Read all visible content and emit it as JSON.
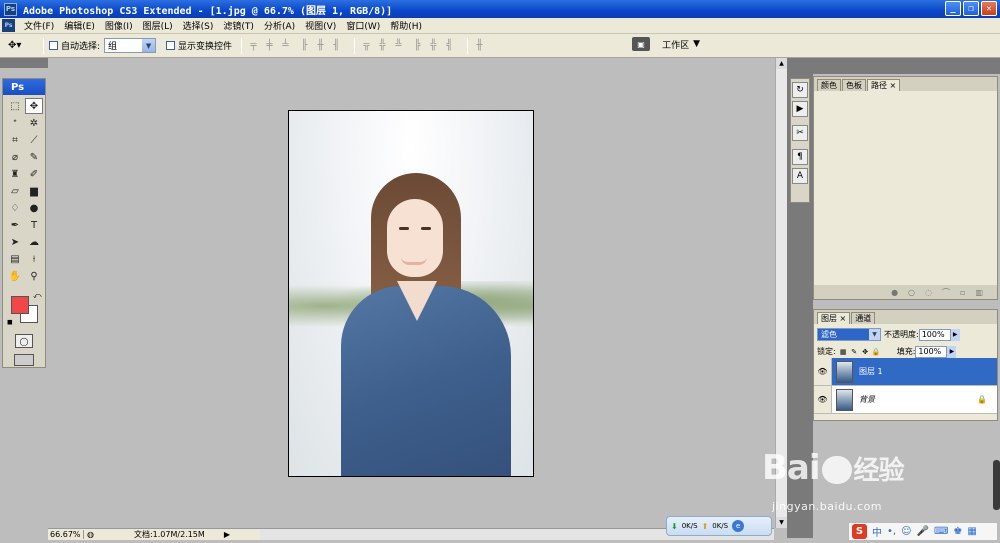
{
  "window": {
    "title": "Adobe Photoshop CS3 Extended - [1.jpg @ 66.7% (图层 1, RGB/8)]",
    "app_badge": "Ps"
  },
  "menubar": {
    "items": [
      "文件(F)",
      "编辑(E)",
      "图像(I)",
      "图层(L)",
      "选择(S)",
      "滤镜(T)",
      "分析(A)",
      "视图(V)",
      "窗口(W)",
      "帮助(H)"
    ]
  },
  "options": {
    "auto_select_label": "自动选择:",
    "auto_select_value": "组",
    "show_transform_label": "显示变换控件",
    "workspace_label": "工作区"
  },
  "toolbox": {
    "header": "Ps",
    "foreground_color": "#f04848",
    "background_color": "#ffffff"
  },
  "paths_panel": {
    "tabs": [
      "颜色",
      "色板",
      "路径"
    ]
  },
  "layers_panel": {
    "tabs": [
      "图层",
      "通道"
    ],
    "blend_mode": "滤色",
    "opacity_label": "不透明度:",
    "opacity_value": "100%",
    "lock_label": "锁定:",
    "fill_label": "填充:",
    "fill_value": "100%",
    "layers": [
      {
        "name": "图层 1",
        "selected": true
      },
      {
        "name": "背景",
        "selected": false
      }
    ]
  },
  "statusbar": {
    "zoom": "66.67%",
    "doc_info": "文档:1.07M/2.15M"
  },
  "network": {
    "down": "0K/S",
    "up": "0K/S"
  },
  "watermark": {
    "brand": "Bai",
    "brand_tail": "经验",
    "url": "jingyan.baidu.com"
  },
  "ime": {
    "label": "中"
  }
}
